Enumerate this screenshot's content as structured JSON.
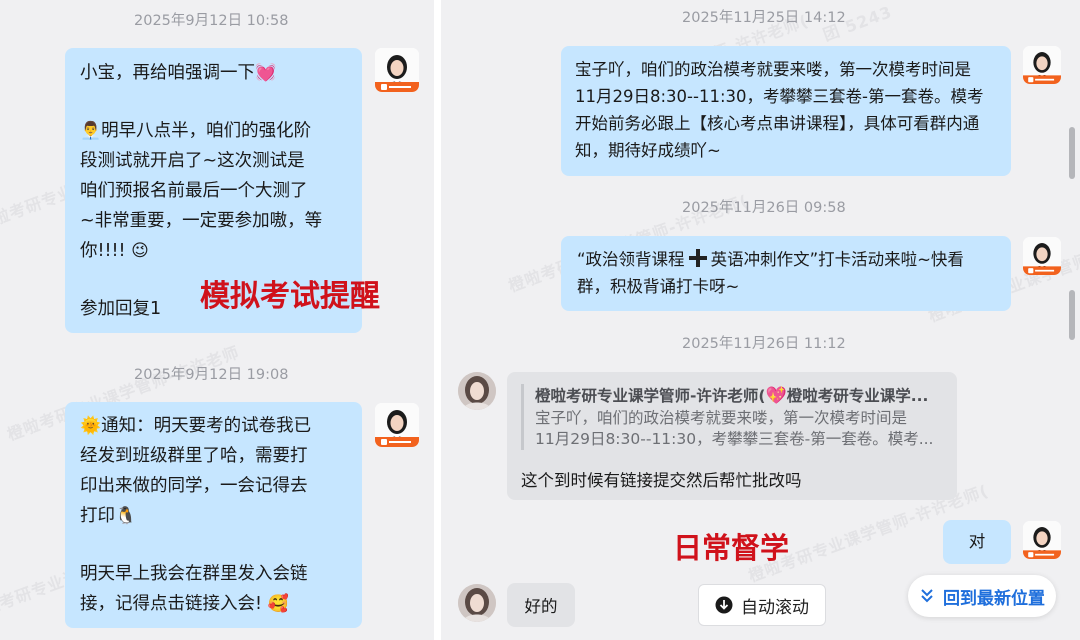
{
  "left": {
    "messages": [
      {
        "time": "2025年9月12日  10:58",
        "lines": [
          "小宝，再给咱强调一下",
          "",
          "明早八点半，咱们的强化阶",
          "段测试就开启了~这次测试是",
          "咱们预报名前最后一个大测了",
          "~非常重要，一定要参加嗷，等",
          "你!!!!",
          "",
          "参加回复1"
        ]
      },
      {
        "time": "2025年9月12日  19:08",
        "lines": [
          "通知：明天要考的试卷我已",
          "经发到班级群里了哈，需要打",
          "印出来做的同学，一会记得去",
          "打印",
          "",
          "明天早上我会在群里发入会链",
          "接，记得点击链接入会!"
        ]
      }
    ],
    "overlay_label": "模拟考试提醒",
    "watermark": "橙啦考研专业课学管师-许许老师"
  },
  "right": {
    "time1": "2025年11月25日 14:12",
    "msg1": [
      "宝子吖，咱们的政治模考就要来喽，第一次模考时间是",
      "11月29日8:30--11:30，考攀攀三套卷-第一套卷。模考",
      "开始前务必跟上【核心考点串讲课程】，具体可看群内通",
      "知，期待好成绩吖~"
    ],
    "time2": "2025年11月26日 09:58",
    "msg2": [
      "“政治领背课程",
      "英语冲刺作文”打卡活动来啦~快看",
      "群，积极背诵打卡呀~"
    ],
    "time3": "2025年11月26日 11:12",
    "quote": {
      "title": "橙啦考研专业课学管师-许许老师(",
      "title_suffix": "橙啦考研专业课学...",
      "lines": [
        "宝子吖，咱们的政治模考就要来喽，第一次模考时间是",
        "11月29日8:30--11:30，考攀攀三套卷-第一套卷。模考..."
      ]
    },
    "reply": "这个到时候有链接提交然后帮忙批改吗",
    "msg_dui": "对",
    "msg_haode": "好的",
    "overlay_label": "日常督学",
    "auto_scroll_label": "自动滚动",
    "back_latest_label": "回到最新位置",
    "watermark": "橙啦考研专业课学管师-许许老师(",
    "watermark_id": "团 5243"
  },
  "colors": {
    "bubble_blue": "#c6e6ff",
    "bubble_gray": "#e2e3e6",
    "overlay_red": "#d0121b",
    "link_blue": "#1f6fdc",
    "brand_orange": "#f2621e"
  },
  "icons": [
    "heart-emoji-icon",
    "person-emoji-icon",
    "wink-emoji-icon",
    "sun-emoji-icon",
    "penguin-icon",
    "smiling-emoji-icon",
    "plus-icon",
    "heart-emoji-icon",
    "down-arrow-circle-icon",
    "double-chevron-down-icon"
  ]
}
